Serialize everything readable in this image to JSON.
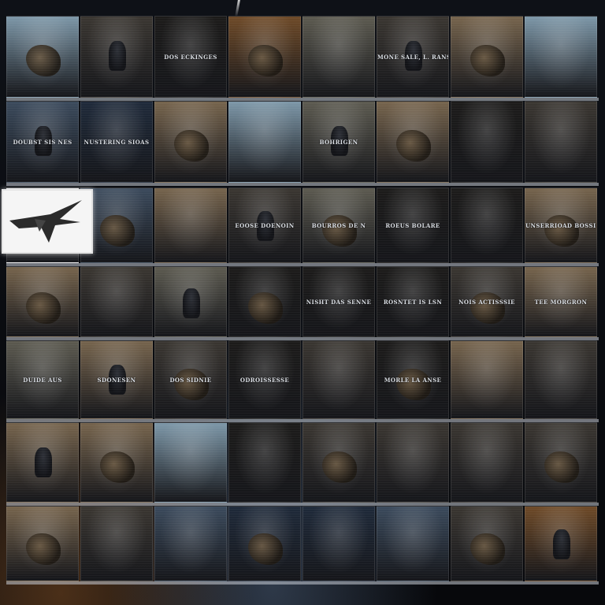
{
  "gallery": {
    "rows": [
      {
        "tiles": [
          {
            "caption": "",
            "tone": "a"
          },
          {
            "caption": "",
            "tone": "d"
          },
          {
            "caption": "DOS ECKINGES",
            "tone": "k"
          },
          {
            "caption": "",
            "tone": "f"
          },
          {
            "caption": "",
            "tone": "g"
          },
          {
            "caption": "MONE SALE, L. RANS",
            "tone": "d"
          },
          {
            "caption": "",
            "tone": "s"
          },
          {
            "caption": "",
            "tone": "a"
          }
        ]
      },
      {
        "tiles": [
          {
            "caption": "DOUBST SIS NES",
            "tone": "b"
          },
          {
            "caption": "NUSTERING SIOAS",
            "tone": "n"
          },
          {
            "caption": "",
            "tone": "s"
          },
          {
            "caption": "",
            "tone": "a"
          },
          {
            "caption": "BOHRIGEN",
            "tone": "g"
          },
          {
            "caption": "",
            "tone": "s"
          },
          {
            "caption": "",
            "tone": "k"
          },
          {
            "caption": "",
            "tone": "d"
          }
        ]
      },
      {
        "tiles": [
          {
            "caption": "",
            "tone": "w"
          },
          {
            "caption": "",
            "tone": "b"
          },
          {
            "caption": "",
            "tone": "s"
          },
          {
            "caption": "EOOSE DOENOIN",
            "tone": "d"
          },
          {
            "caption": "BOURROS DE N",
            "tone": "g"
          },
          {
            "caption": "ROEUS BOLARE",
            "tone": "k"
          },
          {
            "caption": "",
            "tone": "k"
          },
          {
            "caption": "UNSERRIOAD BOSSIOR",
            "tone": "s"
          }
        ]
      },
      {
        "tiles": [
          {
            "caption": "",
            "tone": "s"
          },
          {
            "caption": "",
            "tone": "d"
          },
          {
            "caption": "",
            "tone": "g"
          },
          {
            "caption": "",
            "tone": "k"
          },
          {
            "caption": "NISHT DAS SENNE",
            "tone": "k"
          },
          {
            "caption": "ROSNTET IS LSN",
            "tone": "k"
          },
          {
            "caption": "NOIS ACTISSSIE",
            "tone": "d"
          },
          {
            "caption": "TEE MORGRON",
            "tone": "s"
          }
        ]
      },
      {
        "tiles": [
          {
            "caption": "DUIDE AUS",
            "tone": "g"
          },
          {
            "caption": "SDONESEN",
            "tone": "s"
          },
          {
            "caption": "DOS SIDNIE",
            "tone": "d"
          },
          {
            "caption": "ODROISSESSE",
            "tone": "k"
          },
          {
            "caption": "",
            "tone": "d"
          },
          {
            "caption": "MORLE LA ANSE",
            "tone": "k"
          },
          {
            "caption": "",
            "tone": "s"
          },
          {
            "caption": "",
            "tone": "d"
          }
        ]
      },
      {
        "tiles": [
          {
            "caption": "",
            "tone": "s"
          },
          {
            "caption": "",
            "tone": "s"
          },
          {
            "caption": "",
            "tone": "a"
          },
          {
            "caption": "",
            "tone": "k"
          },
          {
            "caption": "",
            "tone": "d"
          },
          {
            "caption": "",
            "tone": "d"
          },
          {
            "caption": "",
            "tone": "d"
          },
          {
            "caption": "",
            "tone": "d"
          }
        ]
      },
      {
        "tiles": [
          {
            "caption": "",
            "tone": "s"
          },
          {
            "caption": "",
            "tone": "d"
          },
          {
            "caption": "",
            "tone": "b"
          },
          {
            "caption": "",
            "tone": "n"
          },
          {
            "caption": "",
            "tone": "n"
          },
          {
            "caption": "",
            "tone": "b"
          },
          {
            "caption": "",
            "tone": "d"
          },
          {
            "caption": "",
            "tone": "f"
          }
        ]
      }
    ]
  },
  "palette": {
    "a": "#7d97a8",
    "b": "#3b4a5c",
    "d": "#3a3631",
    "f": "#6e4a28",
    "g": "#5c5a50",
    "k": "#1c1b1a",
    "n": "#1f2a3a",
    "s": "#76644d",
    "w": "#f4f4f4"
  }
}
